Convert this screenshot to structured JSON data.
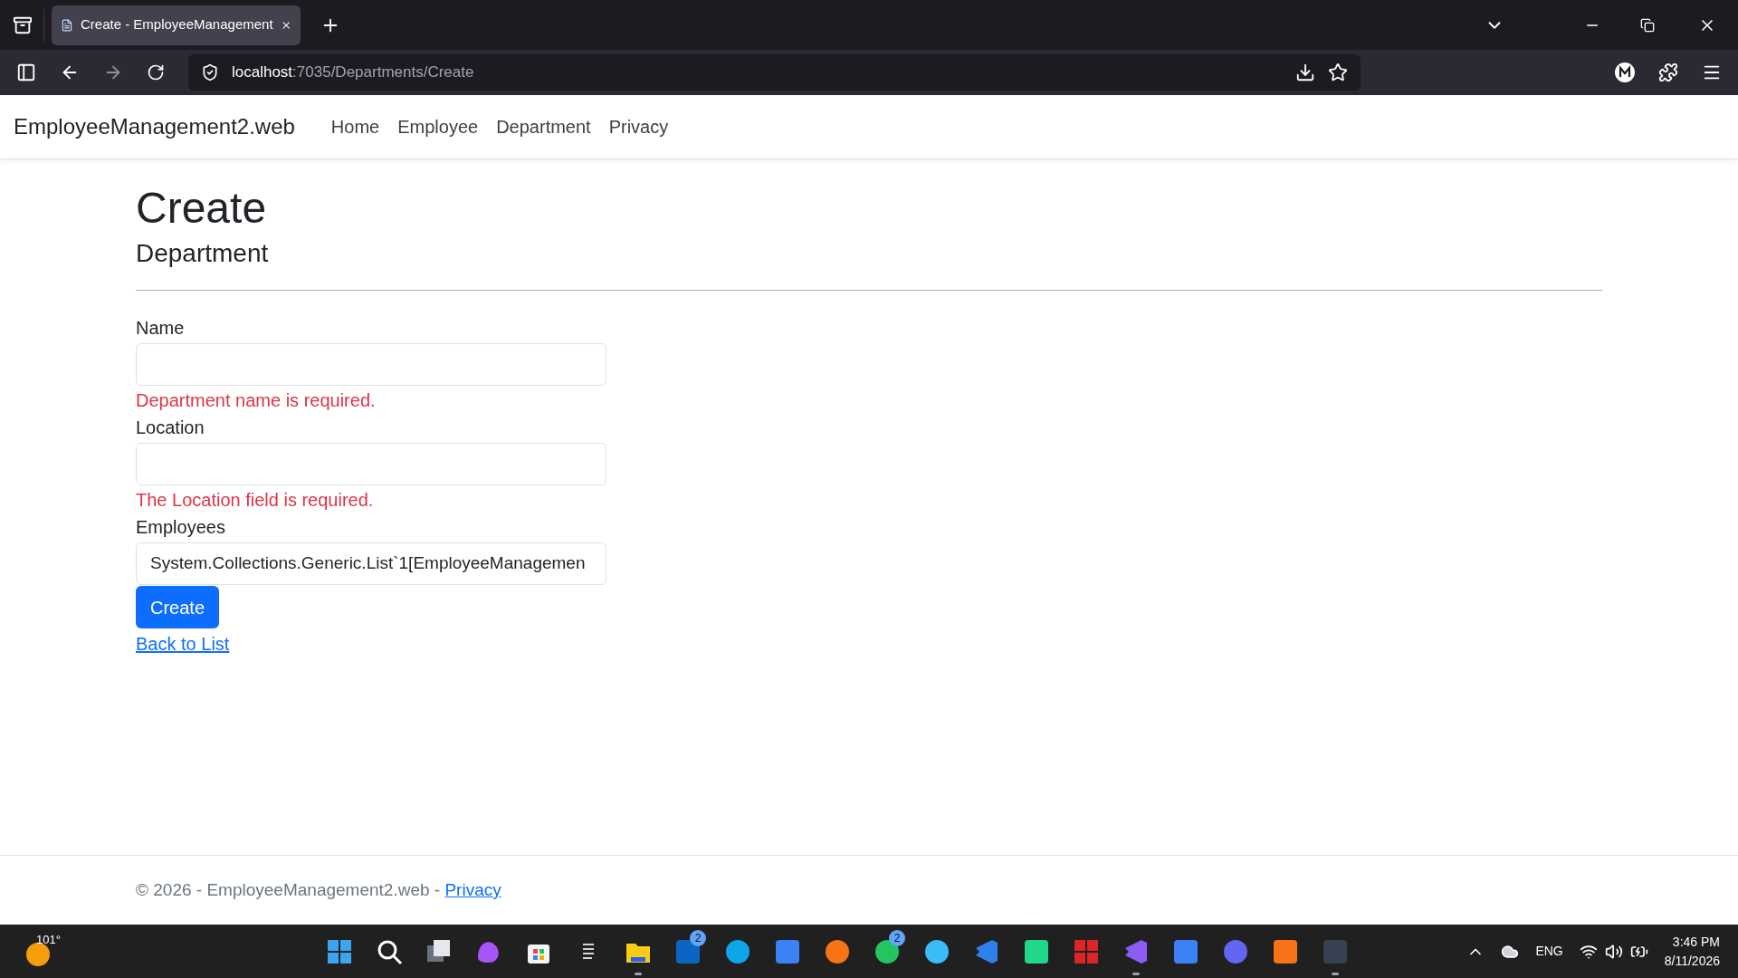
{
  "browser": {
    "tabs": [
      {
        "title": "Create - EmployeeManagement",
        "selected": true
      }
    ],
    "address": {
      "host": "localhost",
      "rest": ":7035/Departments/Create"
    }
  },
  "navbar": {
    "brand": "EmployeeManagement2.web",
    "links": [
      "Home",
      "Employee",
      "Department",
      "Privacy"
    ]
  },
  "page": {
    "title": "Create",
    "subtitle": "Department",
    "fields": [
      {
        "label": "Name",
        "error": "Department name is required."
      },
      {
        "label": "Location",
        "error": "The Location field is required."
      },
      {
        "label": "Employees",
        "value": "System.Collections.Generic.List`1[EmployeeManagemen"
      }
    ],
    "submit": "Create",
    "back_link": "Back to List"
  },
  "footer": {
    "text": "© 2026 - EmployeeManagement2.web - ",
    "link": "Privacy"
  },
  "taskbar": {
    "weather": "101°",
    "apps": [
      {
        "kind": "start",
        "running": false
      },
      {
        "kind": "search",
        "running": false
      },
      {
        "kind": "taskview",
        "running": false
      },
      {
        "kind": "copilot",
        "running": false
      },
      {
        "kind": "store",
        "running": false
      },
      {
        "kind": "notes",
        "running": false
      },
      {
        "kind": "folder",
        "running": true
      },
      {
        "kind": "linkedin",
        "running": false,
        "badge": "2"
      },
      {
        "kind": "edge",
        "running": false
      },
      {
        "kind": "photos",
        "running": false
      },
      {
        "kind": "firefox",
        "running": false
      },
      {
        "kind": "whatsapp",
        "running": false,
        "badge": "2"
      },
      {
        "kind": "telegram",
        "running": false
      },
      {
        "kind": "vscode",
        "running": false
      },
      {
        "kind": "pycharm",
        "running": false
      },
      {
        "kind": "blocks",
        "running": false
      },
      {
        "kind": "vstudio",
        "running": true
      },
      {
        "kind": "hourglass",
        "running": false
      },
      {
        "kind": "teams",
        "running": false
      },
      {
        "kind": "diagram",
        "running": false
      },
      {
        "kind": "terminal",
        "running": true
      }
    ],
    "language": "ENG",
    "time": "3:46 PM",
    "date": "8/11/2026"
  }
}
